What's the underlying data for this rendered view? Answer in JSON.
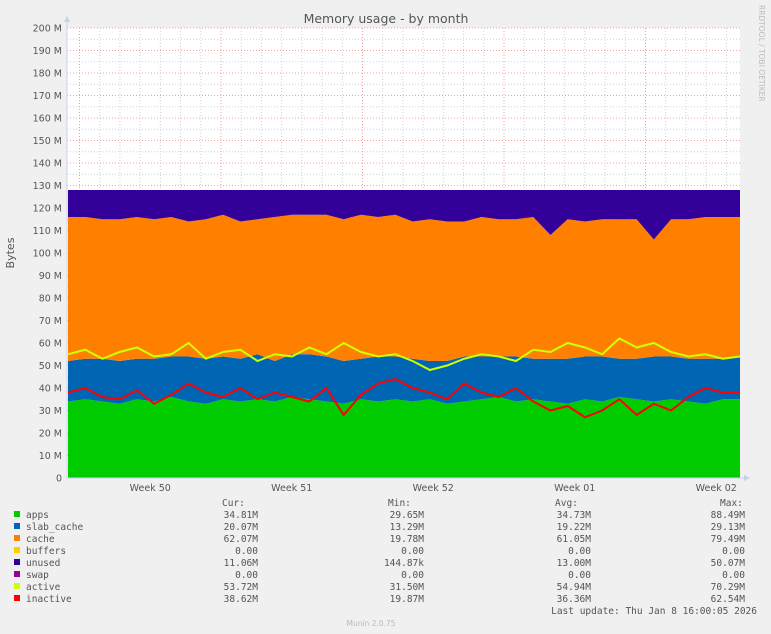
{
  "chart_data": {
    "type": "area",
    "stacked": true,
    "title": "Memory usage - by month",
    "ylabel": "Bytes",
    "xlabel": "",
    "ylim": [
      0,
      200
    ],
    "y_unit": "M",
    "y_ticks": [
      "0",
      "10 M",
      "20 M",
      "30 M",
      "40 M",
      "50 M",
      "60 M",
      "70 M",
      "80 M",
      "90 M",
      "100 M",
      "110 M",
      "120 M",
      "130 M",
      "140 M",
      "150 M",
      "160 M",
      "170 M",
      "180 M",
      "190 M",
      "200 M"
    ],
    "x_ticks": [
      "Week 50",
      "Week 51",
      "Week 52",
      "Week 01",
      "Week 02"
    ],
    "grid": true,
    "watermark": "RRDTOOL / TOBI OETIKER",
    "series": [
      {
        "name": "apps",
        "color": "#00cc00",
        "kind": "area",
        "values": [
          34,
          35,
          34,
          33,
          35,
          34,
          36,
          34,
          33,
          35,
          34,
          35,
          34,
          36,
          35,
          34,
          33,
          35,
          34,
          35,
          34,
          35,
          33,
          34,
          35,
          36,
          34,
          35,
          34,
          33,
          35,
          34,
          36,
          35,
          34,
          35,
          34,
          33,
          35,
          35
        ]
      },
      {
        "name": "slab_cache",
        "color": "#0066b3",
        "kind": "area",
        "values": [
          18,
          18,
          19,
          19,
          18,
          19,
          18,
          20,
          20,
          19,
          19,
          20,
          18,
          19,
          20,
          20,
          19,
          18,
          20,
          19,
          19,
          17,
          19,
          20,
          19,
          18,
          20,
          18,
          19,
          20,
          19,
          20,
          17,
          18,
          20,
          19,
          19,
          20,
          18,
          19
        ]
      },
      {
        "name": "cache",
        "color": "#ff8000",
        "kind": "area",
        "values": [
          64,
          63,
          62,
          63,
          63,
          62,
          62,
          60,
          62,
          63,
          61,
          60,
          64,
          62,
          62,
          63,
          63,
          64,
          62,
          63,
          61,
          63,
          62,
          60,
          62,
          61,
          61,
          63,
          55,
          62,
          60,
          61,
          62,
          62,
          52,
          61,
          62,
          63,
          63,
          62
        ]
      },
      {
        "name": "buffers",
        "color": "#ffcc00",
        "kind": "area",
        "values": [
          0,
          0,
          0,
          0,
          0,
          0,
          0,
          0,
          0,
          0,
          0,
          0,
          0,
          0,
          0,
          0,
          0,
          0,
          0,
          0,
          0,
          0,
          0,
          0,
          0,
          0,
          0,
          0,
          0,
          0,
          0,
          0,
          0,
          0,
          0,
          0,
          0,
          0,
          0,
          0
        ]
      },
      {
        "name": "unused",
        "color": "#330099",
        "kind": "area",
        "values": [
          12,
          12,
          13,
          13,
          12,
          13,
          12,
          14,
          13,
          11,
          14,
          13,
          12,
          11,
          11,
          11,
          13,
          11,
          12,
          11,
          14,
          13,
          14,
          14,
          12,
          13,
          13,
          12,
          20,
          13,
          14,
          13,
          13,
          13,
          22,
          13,
          13,
          12,
          12,
          12
        ]
      },
      {
        "name": "swap",
        "color": "#990099",
        "kind": "area",
        "values": [
          0,
          0,
          0,
          0,
          0,
          0,
          0,
          0,
          0,
          0,
          0,
          0,
          0,
          0,
          0,
          0,
          0,
          0,
          0,
          0,
          0,
          0,
          0,
          0,
          0,
          0,
          0,
          0,
          0,
          0,
          0,
          0,
          0,
          0,
          0,
          0,
          0,
          0,
          0,
          0
        ]
      },
      {
        "name": "active",
        "color": "#ccff00",
        "kind": "line",
        "values": [
          55,
          57,
          53,
          56,
          58,
          54,
          55,
          60,
          53,
          56,
          57,
          52,
          55,
          54,
          58,
          55,
          60,
          56,
          54,
          55,
          52,
          48,
          50,
          53,
          55,
          54,
          52,
          57,
          56,
          60,
          58,
          55,
          62,
          58,
          60,
          56,
          54,
          55,
          53,
          54
        ]
      },
      {
        "name": "inactive",
        "color": "#ff0000",
        "kind": "line",
        "values": [
          38,
          40,
          36,
          35,
          39,
          33,
          37,
          42,
          38,
          36,
          40,
          35,
          38,
          36,
          34,
          40,
          28,
          37,
          42,
          44,
          40,
          38,
          35,
          42,
          38,
          36,
          40,
          34,
          30,
          32,
          27,
          30,
          35,
          28,
          33,
          30,
          36,
          40,
          38,
          38
        ]
      }
    ]
  },
  "legend": {
    "headers": {
      "cur": "Cur:",
      "min": "Min:",
      "avg": "Avg:",
      "max": "Max:"
    },
    "rows": [
      {
        "name": "apps",
        "color": "#00cc00",
        "cur": "34.81M",
        "min": "29.65M",
        "avg": "34.73M",
        "max": "88.49M"
      },
      {
        "name": "slab_cache",
        "color": "#0066b3",
        "cur": "20.07M",
        "min": "13.29M",
        "avg": "19.22M",
        "max": "29.13M"
      },
      {
        "name": "cache",
        "color": "#ff8000",
        "cur": "62.07M",
        "min": "19.78M",
        "avg": "61.05M",
        "max": "79.49M"
      },
      {
        "name": "buffers",
        "color": "#ffcc00",
        "cur": "0.00",
        "min": "0.00",
        "avg": "0.00",
        "max": "0.00"
      },
      {
        "name": "unused",
        "color": "#330099",
        "cur": "11.06M",
        "min": "144.87k",
        "avg": "13.00M",
        "max": "50.07M"
      },
      {
        "name": "swap",
        "color": "#990099",
        "cur": "0.00",
        "min": "0.00",
        "avg": "0.00",
        "max": "0.00"
      },
      {
        "name": "active",
        "color": "#ccff00",
        "cur": "53.72M",
        "min": "31.50M",
        "avg": "54.94M",
        "max": "70.29M"
      },
      {
        "name": "inactive",
        "color": "#ff0000",
        "cur": "38.62M",
        "min": "19.87M",
        "avg": "36.36M",
        "max": "62.54M"
      }
    ],
    "last_update": "Last update: Thu Jan  8 16:00:05 2026"
  },
  "footer": "Munin 2.0.75"
}
